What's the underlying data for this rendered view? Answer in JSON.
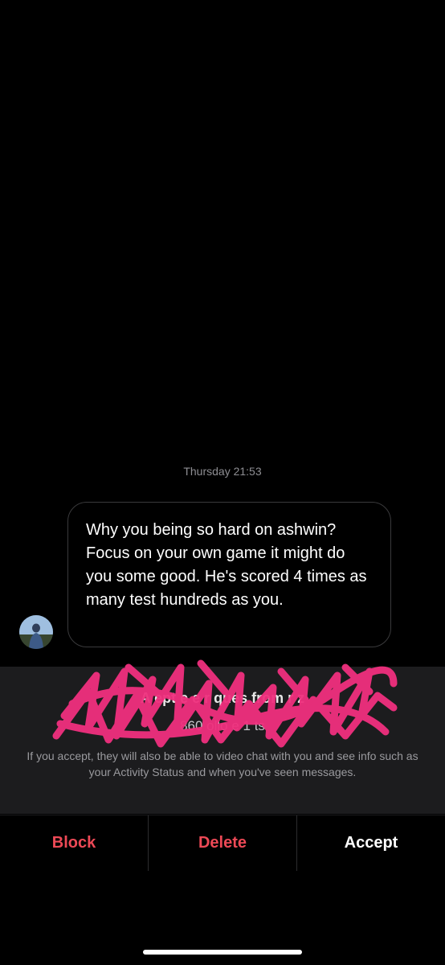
{
  "thread": {
    "timestamp": "Thursday 21:53",
    "message": {
      "text": "Why you being so hard on ashwin? Focus on your own game it might do you some good. He's scored 4 times as many test hundreds as you."
    }
  },
  "request": {
    "title": "A          ept  e      e  r  ques     from   r        z",
    "subtitle": "860       ollo    e     1      ts",
    "info": "If you accept, they will also be able to video chat with you and see info such as your Activity Status and when you've seen messages."
  },
  "actions": {
    "block_label": "Block",
    "delete_label": "Delete",
    "accept_label": "Accept"
  },
  "colors": {
    "background": "#000000",
    "panel": "#1c1c1e",
    "danger": "#ed4956",
    "scribble": "#f0307e"
  },
  "icons": {
    "avatar": "profile-avatar"
  }
}
